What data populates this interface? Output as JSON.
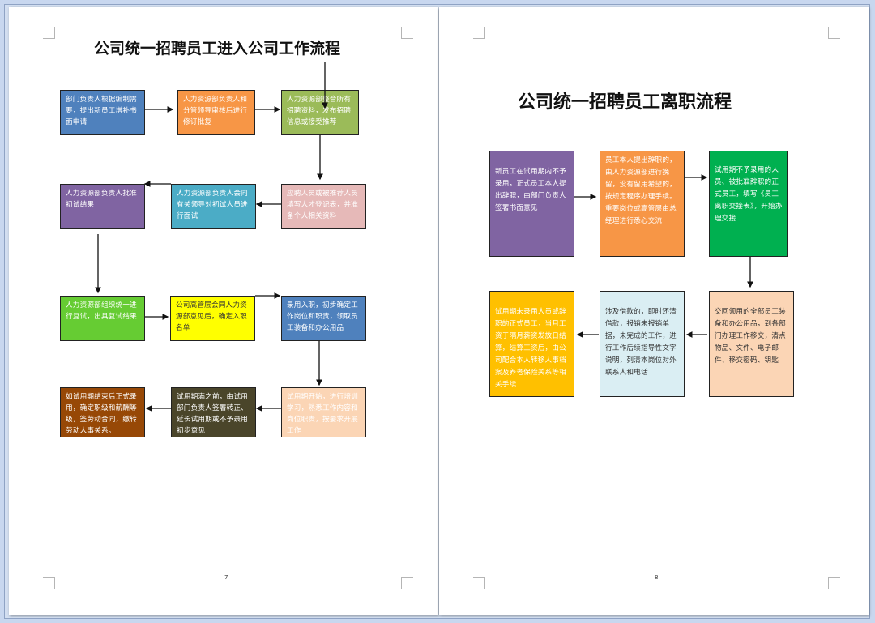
{
  "left_page": {
    "title": "公司统一招聘员工进入公司工作流程",
    "page_number": "7",
    "steps": [
      {
        "text": "部门负责人根据编制需要，提出新员工增补书面申请",
        "color": "#4f81bd",
        "text_color": "#ffffff"
      },
      {
        "text": "人力资源部负责人和分管领导审核后进行修订批复",
        "color": "#f79646",
        "text_color": "#ffffff"
      },
      {
        "text": "人力资源部整合所有招聘资料，发布招聘信息或接受推荐",
        "color": "#9bbb59",
        "text_color": "#ffffff"
      },
      {
        "text": "应聘人员或被推荐人员填写人才登记表，并准备个人相关资料",
        "color": "#e6b9b8",
        "text_color": "#ffffff"
      },
      {
        "text": "人力资源部负责人会同有关领导对初试人员进行面试",
        "color": "#4bacc6",
        "text_color": "#ffffff"
      },
      {
        "text": "人力资源部负责人批准初试结果",
        "color": "#8064a2",
        "text_color": "#ffffff"
      },
      {
        "text": "人力资源部组织统一进行复试，出具复试结果",
        "color": "#66cc33",
        "text_color": "#ffffff"
      },
      {
        "text": "公司高管层会同人力资源部意见后，确定入职名单",
        "color": "#ffff00",
        "text_color": "#333333"
      },
      {
        "text": "录用入职，初步确定工作岗位和职责，领取员工装备和办公用品",
        "color": "#4f81bd",
        "text_color": "#ffffff"
      },
      {
        "text": "试用期开始，进行培训学习，熟悉工作内容和岗位职责，按要求开展工作",
        "color": "#fbd5b5",
        "text_color": "#ffffff"
      },
      {
        "text": "试用期满之前，由试用部门负责人签署转正、延长试用期或不予录用初步意见",
        "color": "#4a452a",
        "text_color": "#ffffff"
      },
      {
        "text": "如试用期结束后正式录用，确定职级和薪酬等级，签劳动合同，缴转劳动人事关系。",
        "color": "#974806",
        "text_color": "#ffffff"
      }
    ]
  },
  "right_page": {
    "title": "公司统一招聘员工离职流程",
    "page_number": "8",
    "steps": [
      {
        "text": "新员工在试用期内不予录用，正式员工本人提出辞职，由部门负责人签署书面意见",
        "color": "#8064a2",
        "text_color": "#ffffff"
      },
      {
        "text": "员工本人提出辞职的，由人力资源部进行挽留，没有留用希望的，按规定程序办理手续。重要岗位或高管层由总经理进行悉心交流",
        "color": "#f79646",
        "text_color": "#ffffff"
      },
      {
        "text": "试用期不予录用的人员、被批准辞职的正式员工，填写《员工离职交接表》，开始办理交接",
        "color": "#00b050",
        "text_color": "#ffffff"
      },
      {
        "text": "交回领用的全部员工装备和办公用品，到各部门办理工作移交，清点物品、文件、电子邮件、移交密码、钥匙",
        "color": "#fbd5b5",
        "text_color": "#333333"
      },
      {
        "text": "涉及借款的，即时还清借款，报销未报销单据，未完成的工作，进行工作后续指导性文字说明，列清本岗位对外联系人和电话",
        "color": "#daeef3",
        "text_color": "#333333"
      },
      {
        "text": "试用期未录用人员或辞职的正式员工，当月工资于隔月薪资发放日结算，结算工资后，由公司配合本人转移人事档案及养老保险关系等相关手续",
        "color": "#ffc000",
        "text_color": "#ffffff"
      }
    ]
  }
}
